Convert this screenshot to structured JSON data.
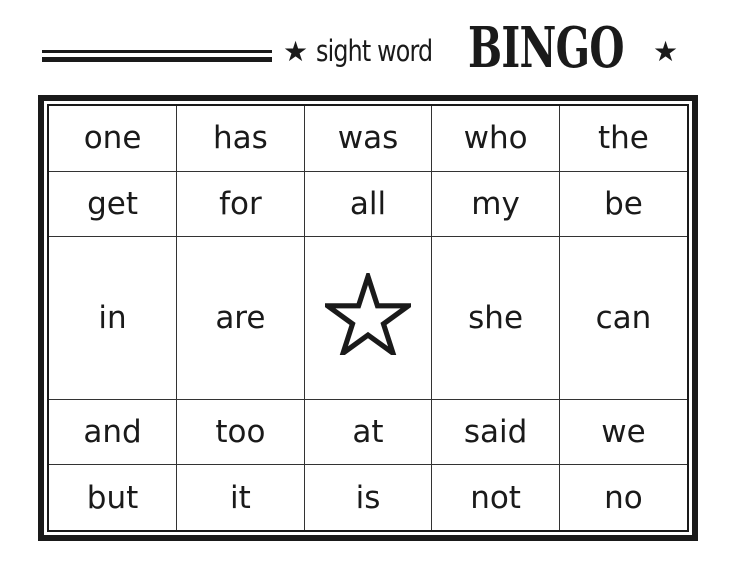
{
  "header": {
    "subtitle": "sight word",
    "title": "BINGO",
    "star_icon": "star-icon"
  },
  "card": {
    "rows": [
      [
        "one",
        "has",
        "was",
        "who",
        "the"
      ],
      [
        "get",
        "for",
        "all",
        "my",
        "be"
      ],
      [
        "in",
        "are",
        "",
        "she",
        "can"
      ],
      [
        "and",
        "too",
        "at",
        "said",
        "we"
      ],
      [
        "but",
        "it",
        "is",
        "not",
        "no"
      ]
    ],
    "free_space_icon": "star-outline-icon"
  }
}
